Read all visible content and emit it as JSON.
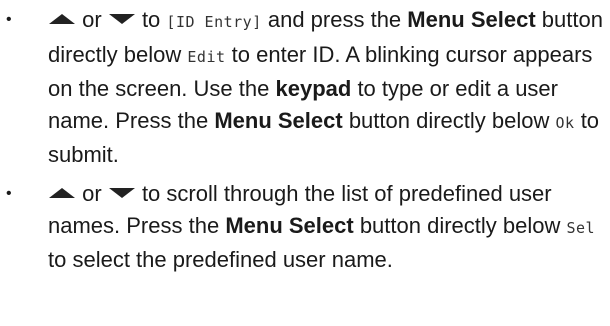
{
  "bullets": [
    {
      "marker": "•",
      "arrow_up_icon": "triangle-up-icon",
      "arrow_down_icon": "triangle-down-icon",
      "t1": "or",
      "t2": "to",
      "screen_entry": "[ID Entry]",
      "t3": "and press the",
      "menu_select_1": "Menu Select",
      "t4": "button directly below",
      "screen_edit": "Edit",
      "t5": "to enter ID. A blinking cursor appears on the screen. Use the",
      "keypad": "keypad",
      "t6": "to type or edit a user name. Press the",
      "menu_select_2": "Menu Select",
      "t7": "button directly below",
      "screen_ok": "Ok",
      "t8": "to submit."
    },
    {
      "marker": "•",
      "arrow_up_icon": "triangle-up-icon",
      "arrow_down_icon": "triangle-down-icon",
      "t1": "or",
      "t2": "to scroll through the list of predefined user names. Press the",
      "menu_select": "Menu Select",
      "t3": "button directly below",
      "screen_sel": "Sel",
      "t4": "to select the predefined user name."
    }
  ]
}
